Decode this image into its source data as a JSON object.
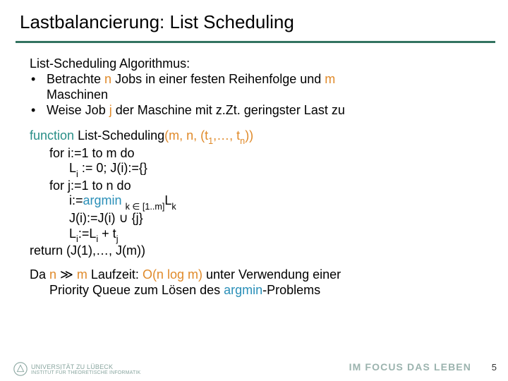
{
  "title": "Lastbalancierung: List Scheduling",
  "section_heading": "List-Scheduling Algorithmus:",
  "bullets": {
    "b1_pre": "Betrachte ",
    "b1_n": "n",
    "b1_mid": " Jobs in einer festen Reihenfolge und ",
    "b1_m": "m",
    "b1_post": " Maschinen",
    "b2_pre": "Weise Job ",
    "b2_j": "j",
    "b2_post": " der Maschine mit z.Zt. geringster Last zu"
  },
  "code": {
    "fn_kw": "function",
    "fn_name": "List-Scheduling",
    "sig_open": "(m, n, (t",
    "sig_sub1": "1",
    "sig_mid": ",…, t",
    "sig_subn": "n",
    "sig_close": "))",
    "for_i": "for i:=1 to m do",
    "init_L": "L",
    "init_L_sub": "i",
    "init_L_rest": " := 0; J(i):={}",
    "for_j": "for j:=1 to n do",
    "argmin_pre": "i:=",
    "argmin_fn": "argmin",
    "argmin_mid": " ",
    "argmin_k": "k ∈ [1..m]",
    "argmin_Lk_L": "L",
    "argmin_Lk_k": "k",
    "j_update": "J(i):=J(i) ∪ {j}",
    "L_update_L1": "L",
    "L_update_i1": "i",
    "L_update_mid": ":=L",
    "L_update_i2": "i",
    "L_update_plus": " + t",
    "L_update_j": "j",
    "ret": "return (J(1),…, J(m))"
  },
  "runtime": {
    "pre": "Da ",
    "n": "n",
    "gg": " ≫ ",
    "m": "m",
    "mid1": " Laufzeit: ",
    "comp": "O(n log m)",
    "mid2": " unter Verwendung einer",
    "line2a": "Priority Queue zum Lösen des ",
    "argmin": "argmin",
    "line2b": "-Problems"
  },
  "footer": {
    "uni_line1": "UNIVERSITÄT ZU LÜBECK",
    "uni_line2": "INSTITUT FÜR THEORETISCHE INFORMATIK",
    "right": "IM FOCUS DAS LEBEN",
    "page": "5"
  },
  "colors": {
    "accent_rule": "#337360",
    "var": "#e08a2a",
    "fn": "#2a8fb8",
    "teal": "#2a8f88"
  }
}
